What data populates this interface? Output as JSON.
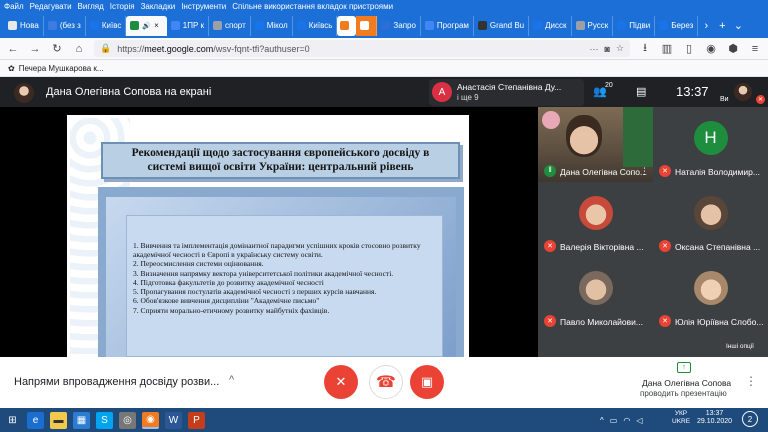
{
  "menu": [
    "Файл",
    "Редагувати",
    "Вигляд",
    "Історія",
    "Закладки",
    "Інструменти",
    "Спільне використання вкладок пристроями"
  ],
  "tabs": [
    {
      "label": "Нова",
      "color": "#e8e8e8"
    },
    {
      "label": "(без з",
      "color": "#3c7be0"
    },
    {
      "label": "Київс",
      "color": "#1a73e8"
    },
    {
      "label": "",
      "color": "#1e8e3e",
      "active": true
    },
    {
      "label": "1ПР к",
      "color": "#4285f4"
    },
    {
      "label": "спорт",
      "color": "#9aa0a6"
    },
    {
      "label": "Мікол",
      "color": "#1a73e8"
    },
    {
      "label": "Київсь",
      "color": "#1a73e8"
    },
    {
      "label": "",
      "color": "#f27b1f",
      "firefox": true
    },
    {
      "label": "",
      "color": "#ffffff",
      "orange": true
    },
    {
      "label": "Запро",
      "color": "#2b6fd6"
    },
    {
      "label": "Програм",
      "color": "#4285f4"
    },
    {
      "label": "Grand Bu",
      "color": "#333333"
    },
    {
      "label": "Дисск",
      "color": "#1a73e8"
    },
    {
      "label": "Русск",
      "color": "#9aa0a6"
    },
    {
      "label": "Підви",
      "color": "#1a73e8"
    },
    {
      "label": "Берез",
      "color": "#1a73e8"
    }
  ],
  "nav": {
    "url_prefix": "https://",
    "url_host": "meet.google.com",
    "url_path": "/wsv-fqnt-tfi?authuser=0"
  },
  "bookmarks": {
    "label": "Печера Мушкарова к..."
  },
  "meet": {
    "presenter_title": "Дана Олегівна Сопова на екрані",
    "notification": {
      "initial": "А",
      "name": "Анастасія Степанівна Ду...",
      "more": "і ще 9"
    },
    "participant_count": "20",
    "clock": "13:37",
    "self_label": "Ви",
    "meeting_title": "Напрями впровадження досвіду розви...",
    "presenting_name": "Дана Олегівна Сопова",
    "presenting_sub": "проводить презентацію",
    "tooltip": "Інші опції"
  },
  "slide": {
    "title": "Рекомендації щодо застосування європейського досвіду в системі вищої освіти України: центральний рівень",
    "items": [
      "1. Вивчення та імплементація домінантної парадигми успішних кроків стосовно розвитку академічної чесності в Європі в українську систему освіти.",
      "2. Переосмислення системи оцінювання.",
      "3. Визначення напрямку вектора університетської політики академічної чесності.",
      "4. Підготовка факультетів до розвитку академічної чесності",
      "5. Пропагування постулатів академічної чесності з перших курсів навчання.",
      "6. Обов'язкове вивчення дисципліни \"Академічне письмо\"",
      "7. Сприяти морально-етичному розвитку майбутніх фахівців."
    ]
  },
  "participants": [
    {
      "name": "Дана Олегівна Сопо...",
      "type": "video"
    },
    {
      "name": "Наталія Володимир...",
      "type": "initial",
      "initial": "Н"
    },
    {
      "name": "Валерія Вікторівна ...",
      "type": "face",
      "color": "#c84a3a"
    },
    {
      "name": "Оксана Степанівна ...",
      "type": "face",
      "color": "#5a4638"
    },
    {
      "name": "Павло Миколайови...",
      "type": "face",
      "color": "#7a6a5e"
    },
    {
      "name": "Юлія Юріївна Слобо...",
      "type": "face",
      "color": "#a8886a"
    }
  ],
  "tray": {
    "lang_top": "УКР",
    "lang_bottom": "UKRE",
    "time": "13:37",
    "date": "29.10.2020",
    "notifications": "2"
  }
}
